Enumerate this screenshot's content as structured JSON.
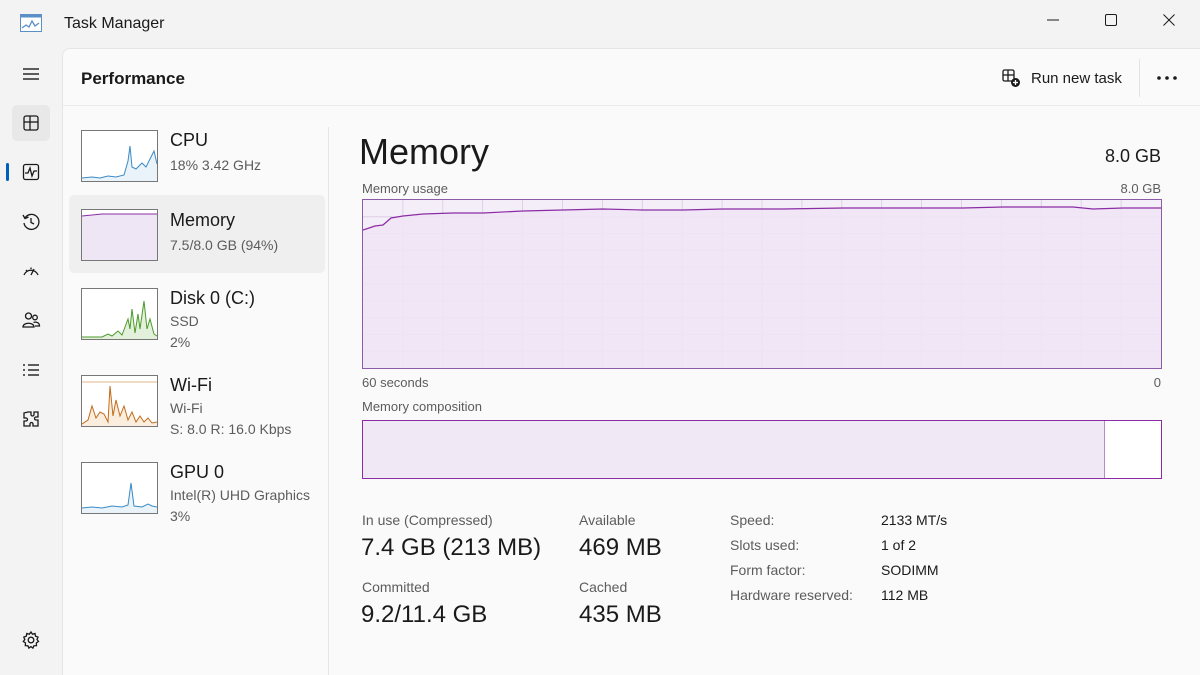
{
  "window": {
    "title": "Task Manager"
  },
  "header": {
    "title": "Performance",
    "run_new_task": "Run new task"
  },
  "devices": [
    {
      "name": "CPU",
      "line1": "18%  3.42 GHz",
      "line2": ""
    },
    {
      "name": "Memory",
      "line1": "7.5/8.0 GB (94%)",
      "line2": ""
    },
    {
      "name": "Disk 0 (C:)",
      "line1": "SSD",
      "line2": "2%"
    },
    {
      "name": "Wi-Fi",
      "line1": "Wi-Fi",
      "line2": "S: 8.0  R: 16.0 Kbps"
    },
    {
      "name": "GPU 0",
      "line1": "Intel(R) UHD Graphics",
      "line2": "3%"
    }
  ],
  "detail": {
    "title": "Memory",
    "total": "8.0 GB",
    "usage_label": "Memory usage",
    "usage_max": "8.0 GB",
    "time_left": "60 seconds",
    "time_right": "0",
    "composition_label": "Memory composition",
    "composition_in_use_fraction": 0.93,
    "stats": {
      "in_use_label": "In use (Compressed)",
      "in_use_value": "7.4 GB (213 MB)",
      "available_label": "Available",
      "available_value": "469 MB",
      "committed_label": "Committed",
      "committed_value": "9.2/11.4 GB",
      "cached_label": "Cached",
      "cached_value": "435 MB"
    },
    "specs": [
      {
        "key": "Speed:",
        "value": "2133 MT/s"
      },
      {
        "key": "Slots used:",
        "value": "1 of 2"
      },
      {
        "key": "Form factor:",
        "value": "SODIMM"
      },
      {
        "key": "Hardware reserved:",
        "value": "112 MB"
      }
    ]
  },
  "colors": {
    "memory_line": "#8b2ca5",
    "memory_fill": "#f4eef8",
    "cpu_line": "#3a8bc4",
    "disk_line": "#4c9a2a",
    "wifi_line": "#c26b1a",
    "gpu_line": "#3a8bc4",
    "accent": "#005fb8"
  },
  "icons": {
    "rail": [
      "hamburger-icon",
      "performance-icon",
      "app-history-icon",
      "history-icon",
      "startup-icon",
      "users-icon",
      "details-icon",
      "services-icon",
      "settings-icon"
    ]
  }
}
